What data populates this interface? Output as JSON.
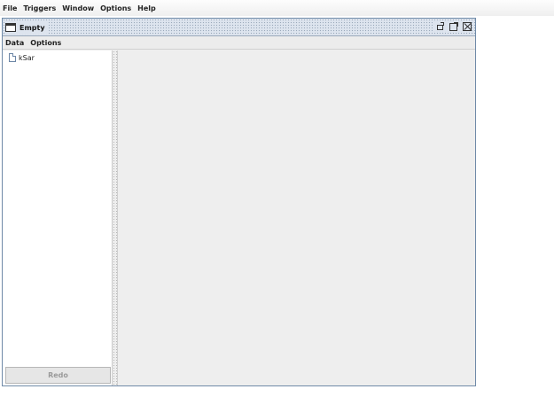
{
  "app_menu": [
    "File",
    "Triggers",
    "Window",
    "Options",
    "Help"
  ],
  "frame": {
    "title": "Empty",
    "menu": [
      "Data",
      "Options"
    ]
  },
  "tree": {
    "items": [
      {
        "label": "kSar",
        "icon": "document-icon"
      }
    ]
  },
  "buttons": {
    "redo_label": "Redo"
  }
}
